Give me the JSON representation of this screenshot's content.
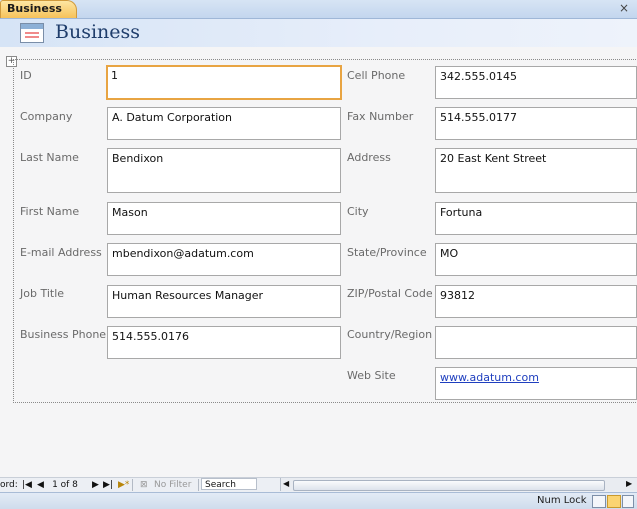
{
  "tab": {
    "label": "Business",
    "close": "×"
  },
  "header": {
    "title": "Business"
  },
  "form": {
    "left": [
      {
        "label": "ID",
        "value": "1"
      },
      {
        "label": "Company",
        "value": "A. Datum Corporation"
      },
      {
        "label": "Last Name",
        "value": "Bendixon"
      },
      {
        "label": "First Name",
        "value": "Mason"
      },
      {
        "label": "E-mail Address",
        "value": "mbendixon@adatum.com"
      },
      {
        "label": "Job Title",
        "value": "Human Resources Manager"
      },
      {
        "label": "Business Phone",
        "value": "514.555.0176"
      }
    ],
    "right": [
      {
        "label": "Cell Phone",
        "value": "342.555.0145"
      },
      {
        "label": "Fax Number",
        "value": "514.555.0177"
      },
      {
        "label": "Address",
        "value": "20 East Kent Street"
      },
      {
        "label": "City",
        "value": "Fortuna"
      },
      {
        "label": "State/Province",
        "value": "MO"
      },
      {
        "label": "ZIP/Postal Code",
        "value": "93812"
      },
      {
        "label": "Country/Region",
        "value": ""
      },
      {
        "label": "Web Site",
        "value": "www.adatum.com"
      }
    ]
  },
  "navigation": {
    "record_label": "ord:",
    "position": "1 of 8",
    "filter": "No Filter",
    "search": "Search"
  },
  "status": {
    "num_lock": "Num Lock"
  },
  "colors": {
    "focus": "#e8a442",
    "link": "#1f3fbf",
    "tab": "#f7c25a"
  }
}
